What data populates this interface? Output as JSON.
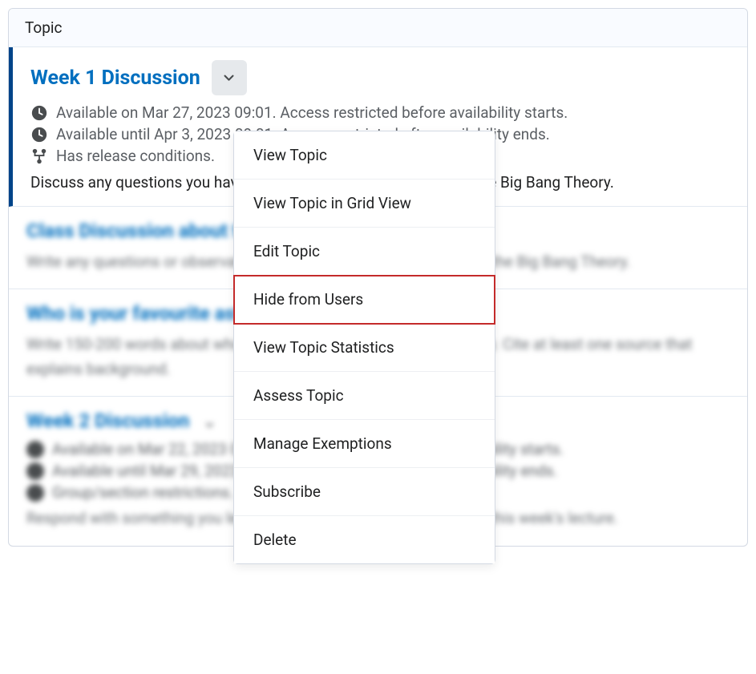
{
  "header": {
    "label": "Topic"
  },
  "topic1": {
    "title": "Week 1 Discussion",
    "avail_start": "Available on Mar 27, 2023 09:01. Access restricted before availability starts.",
    "avail_end": "Available until Apr 3, 2023 09:01. Access restricted after availability ends.",
    "release": "Has release conditions.",
    "desc": "Discuss any questions you have about this week's readings about the Big Bang Theory."
  },
  "menu": {
    "items": [
      "View Topic",
      "View Topic in Grid View",
      "Edit Topic",
      "Hide from Users",
      "View Topic Statistics",
      "Assess Topic",
      "Manage Exemptions",
      "Subscribe",
      "Delete"
    ],
    "highlight_index": 3
  },
  "topic2": {
    "title": "Class Discussion about the Big Bang Theory",
    "desc": "Write any questions or observations from this week's readings about the Big Bang Theory."
  },
  "topic3": {
    "title": "Who is your favourite astronomer?",
    "desc": "Write 150-200 words about who your favourite astronomer is and why. Cite at least one source that explains background."
  },
  "topic4": {
    "title": "Week 2 Discussion",
    "avail_start": "Available on Mar 22, 2023 09:01. Access restricted before availability starts.",
    "avail_end": "Available until Mar 29, 2023 09:01. Access restricted after availability ends.",
    "group": "Group/section restrictions.",
    "desc": "Respond with something you learned and a question you have about this week's lecture."
  }
}
